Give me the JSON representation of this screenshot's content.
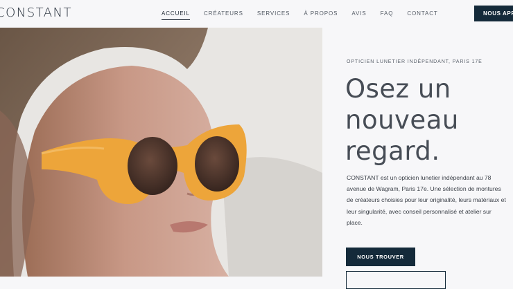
{
  "brand": {
    "logo_text": "CONSTANT"
  },
  "nav": {
    "items": [
      {
        "label": "ACCUEIL",
        "active": true
      },
      {
        "label": "CRÉATEURS"
      },
      {
        "label": "SERVICES"
      },
      {
        "label": "À PROPOS"
      },
      {
        "label": "AVIS"
      },
      {
        "label": "FAQ"
      },
      {
        "label": "CONTACT"
      }
    ],
    "cta_label": "NOUS APPELER"
  },
  "hero": {
    "image_icon": "portrait-photo",
    "eyebrow": "OPTICIEN LUNETIER INDÉPENDANT, PARIS 17E",
    "headline": "Osez un nouveau regard.",
    "description": "CONSTANT est un opticien lunetier indépendant au 78 avenue de Wagram, Paris 17e. Une sélection de montures de créateurs choisies pour leur originalité, leurs matériaux et leur singularité, avec conseil personnalisé et atelier sur place.",
    "primary_button": "NOUS TROUVER",
    "secondary_button": ""
  },
  "colors": {
    "accent_dark": "#142a3a",
    "background": "#f7f7f9",
    "frame_amber": "#eda53a"
  }
}
